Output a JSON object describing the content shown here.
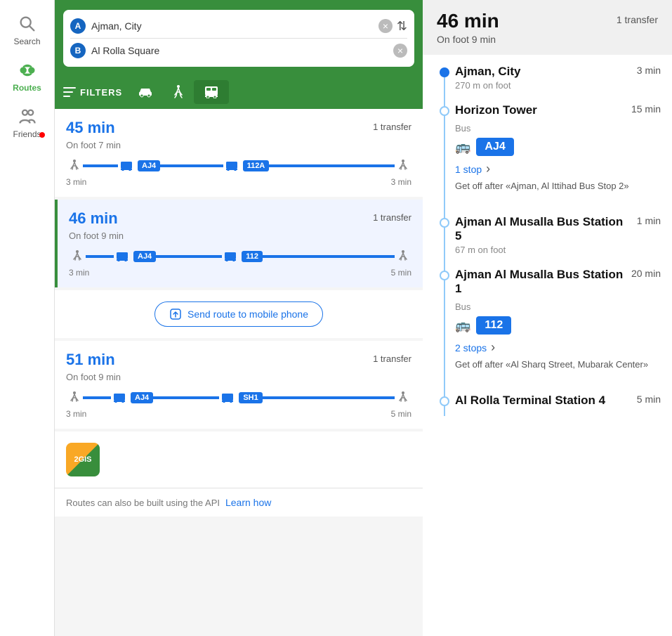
{
  "sidebar": {
    "items": [
      {
        "id": "search",
        "label": "Search",
        "active": false
      },
      {
        "id": "routes",
        "label": "Routes",
        "active": true
      },
      {
        "id": "friends",
        "label": "Friends",
        "active": false
      }
    ]
  },
  "search": {
    "origin": "Ajman, City",
    "destination": "Al Rolla Square",
    "origin_badge": "A",
    "destination_badge": "B"
  },
  "filters": {
    "label": "FILTERS",
    "modes": [
      "car",
      "walk",
      "bus"
    ]
  },
  "routes": [
    {
      "time": "45 min",
      "transfer": "1 transfer",
      "foot": "On foot 7 min",
      "buses": [
        "AJ4",
        "112A"
      ],
      "time_start": "3 min",
      "time_end": "3 min",
      "selected": false
    },
    {
      "time": "46 min",
      "transfer": "1 transfer",
      "foot": "On foot 9 min",
      "buses": [
        "AJ4",
        "112"
      ],
      "time_start": "3 min",
      "time_end": "5 min",
      "selected": true
    },
    {
      "time": "51 min",
      "transfer": "1 transfer",
      "foot": "On foot 9 min",
      "buses": [
        "AJ4",
        "SH1"
      ],
      "time_start": "3 min",
      "time_end": "5 min",
      "selected": false
    }
  ],
  "send_route": {
    "label": "Send route to mobile phone"
  },
  "bottom_bar": {
    "text": "Routes can also be built using the API",
    "learn_how": "Learn how"
  },
  "detail": {
    "time": "46 min",
    "foot": "On foot 9 min",
    "transfer": "1 transfer",
    "stops": [
      {
        "name": "Ajman, City",
        "time": "3 min",
        "sub": "270 m on foot",
        "type": "origin"
      },
      {
        "name": "Horizon Tower",
        "time": "15 min",
        "sub": "",
        "type": "transfer",
        "bus_label": "Bus",
        "bus_num": "AJ4",
        "stops_label": "1 stop",
        "getoff": "Get off after «Ajman, Al Ittihad Bus Stop 2»"
      },
      {
        "name": "Ajman Al Musalla Bus Station 5",
        "time": "1 min",
        "sub": "67 m on foot",
        "type": "waypoint"
      },
      {
        "name": "Ajman Al Musalla Bus Station 1",
        "time": "20 min",
        "sub": "",
        "type": "transfer",
        "bus_label": "Bus",
        "bus_num": "112",
        "stops_label": "2 stops",
        "getoff": "Get off after «Al Sharq Street, Mubarak Center»"
      },
      {
        "name": "Al Rolla Terminal Station 4",
        "time": "5 min",
        "sub": "",
        "type": "destination"
      }
    ]
  }
}
